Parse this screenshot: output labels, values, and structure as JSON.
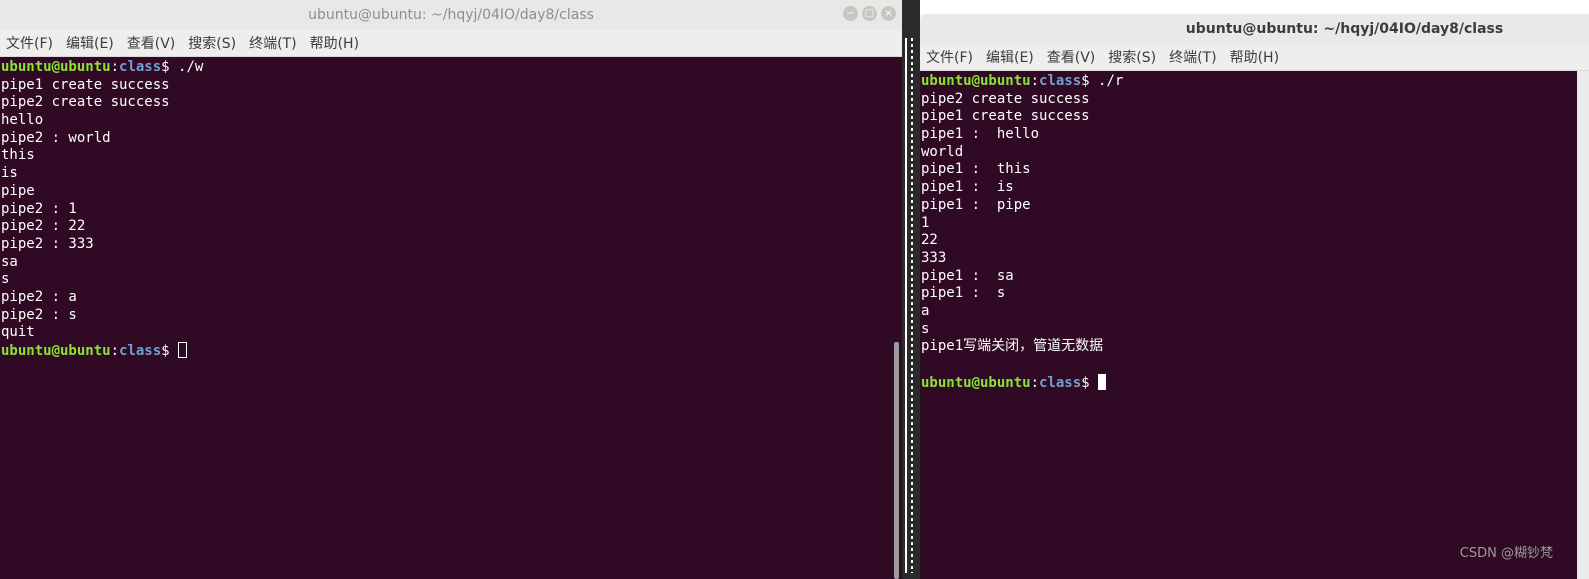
{
  "left_window": {
    "title": "ubuntu@ubuntu: ~/hqyj/04IO/day8/class",
    "controls": [
      "−",
      "□",
      "×"
    ],
    "menu": [
      "文件(F)",
      "编辑(E)",
      "查看(V)",
      "搜索(S)",
      "终端(T)",
      "帮助(H)"
    ],
    "prompt": {
      "user": "ubuntu@ubuntu",
      "sep": ":",
      "path": "class",
      "sym": "$ "
    },
    "command": "./w",
    "output": [
      "pipe1 create success",
      "pipe2 create success",
      "hello",
      "pipe2 : world",
      "this",
      "is",
      "pipe",
      "pipe2 : 1",
      "pipe2 : 22",
      "pipe2 : 333",
      "sa",
      "s",
      "pipe2 : a",
      "pipe2 : s",
      "quit"
    ]
  },
  "right_window": {
    "title": "ubuntu@ubuntu: ~/hqyj/04IO/day8/class",
    "menu": [
      "文件(F)",
      "编辑(E)",
      "查看(V)",
      "搜索(S)",
      "终端(T)",
      "帮助(H)"
    ],
    "prompt": {
      "user": "ubuntu@ubuntu",
      "sep": ":",
      "path": "class",
      "sym": "$ "
    },
    "command": "./r",
    "output": [
      "pipe2 create success",
      "pipe1 create success",
      "pipe1 :  hello",
      "world",
      "pipe1 :  this",
      "pipe1 :  is",
      "pipe1 :  pipe",
      "1",
      "22",
      "333",
      "pipe1 :  sa",
      "pipe1 :  s",
      "a",
      "s",
      "pipe1写端关闭，管道无数据",
      ""
    ]
  },
  "watermark": "CSDN @糊钞梵",
  "colors": {
    "terminal_bg": "#300a24",
    "prompt_user": "#8ae234",
    "prompt_path": "#729fcf"
  }
}
